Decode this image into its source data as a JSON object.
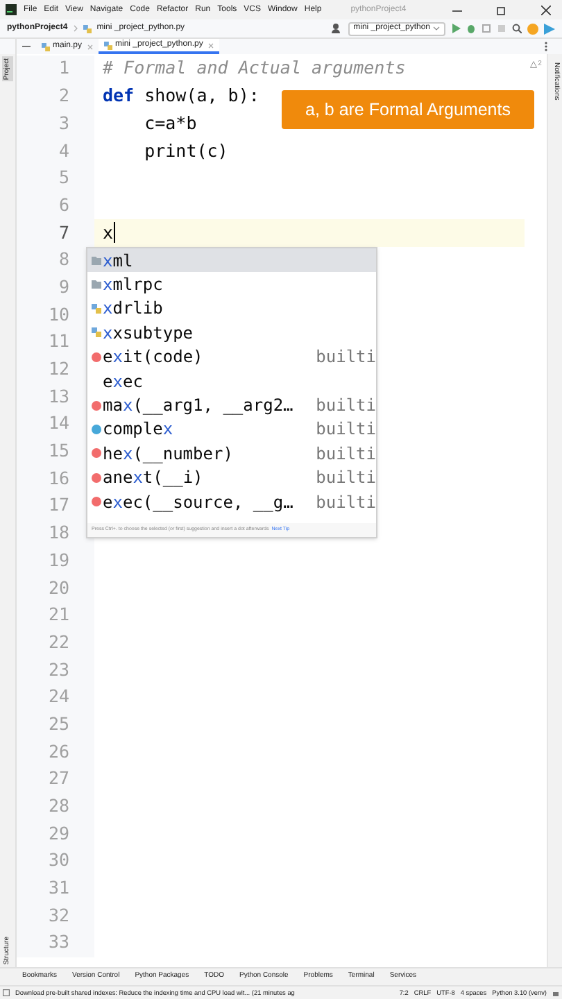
{
  "window": {
    "title": "pythonProject4",
    "menu": [
      "File",
      "Edit",
      "View",
      "Navigate",
      "Code",
      "Refactor",
      "Run",
      "Tools",
      "VCS",
      "Window",
      "Help"
    ]
  },
  "breadcrumb": [
    "pythonProject4",
    "mini _project_python.py"
  ],
  "run_config": "mini _project_python",
  "tabs": [
    {
      "label": "main.py",
      "selected": false
    },
    {
      "label": "mini _project_python.py",
      "selected": true
    }
  ],
  "side_labels": {
    "left_top": "Project",
    "left_bottom": "Structure",
    "right": "Notifications"
  },
  "inspection": {
    "warnings": "2"
  },
  "editor": {
    "lines": [
      {
        "number": "1",
        "current": false,
        "tokens": [
          {
            "kind": "comment",
            "text": "# Formal and Actual arguments"
          }
        ]
      },
      {
        "number": "2",
        "current": false,
        "tokens": [
          {
            "kind": "keyword",
            "text": "def"
          },
          {
            "kind": "plain",
            "text": " show(a, b):"
          }
        ]
      },
      {
        "number": "3",
        "current": false,
        "tokens": [
          {
            "kind": "plain",
            "text": "    c=a*b"
          }
        ]
      },
      {
        "number": "4",
        "current": false,
        "tokens": [
          {
            "kind": "plain",
            "text": "    print(c)"
          }
        ]
      },
      {
        "number": "5",
        "current": false
      },
      {
        "number": "6",
        "current": false
      },
      {
        "number": "7",
        "current": true,
        "tokens": [
          {
            "kind": "plain",
            "text": "x"
          }
        ]
      },
      {
        "number": "8",
        "current": false
      },
      {
        "number": "9",
        "current": false
      },
      {
        "number": "10",
        "current": false
      },
      {
        "number": "11",
        "current": false
      },
      {
        "number": "12",
        "current": false
      },
      {
        "number": "13",
        "current": false
      },
      {
        "number": "14",
        "current": false
      },
      {
        "number": "15",
        "current": false
      },
      {
        "number": "16",
        "current": false
      },
      {
        "number": "17",
        "current": false
      },
      {
        "number": "18",
        "current": false
      },
      {
        "number": "19",
        "current": false
      },
      {
        "number": "20",
        "current": false
      },
      {
        "number": "21",
        "current": false
      },
      {
        "number": "22",
        "current": false
      },
      {
        "number": "23",
        "current": false
      },
      {
        "number": "24",
        "current": false
      },
      {
        "number": "25",
        "current": false
      },
      {
        "number": "26",
        "current": false
      },
      {
        "number": "27",
        "current": false
      },
      {
        "number": "28",
        "current": false
      },
      {
        "number": "29",
        "current": false
      },
      {
        "number": "30",
        "current": false
      },
      {
        "number": "31",
        "current": false
      },
      {
        "number": "32",
        "current": false
      },
      {
        "number": "33",
        "current": false
      }
    ]
  },
  "annotation": "a, b are Formal Arguments",
  "completion": {
    "items": [
      {
        "kind": "package",
        "match": "x",
        "after": "ml",
        "selected": true
      },
      {
        "kind": "package",
        "match": "x",
        "after": "mlrpc",
        "selected": false
      },
      {
        "kind": "module",
        "match": "x",
        "after": "drlib",
        "selected": false
      },
      {
        "kind": "module",
        "match": "x",
        "after": "xsubtype",
        "selected": false
      },
      {
        "kind": "function",
        "before": "e",
        "match": "x",
        "after": "it(code)",
        "type": "builti",
        "selected": false
      },
      {
        "kind": "keyword",
        "before": "e",
        "match": "x",
        "after": "ec",
        "selected": false
      },
      {
        "kind": "function",
        "before": "ma",
        "match": "x",
        "after": "(__arg1, __arg2…",
        "type": "builti",
        "selected": false
      },
      {
        "kind": "class",
        "before": "comple",
        "match": "x",
        "type": "builti",
        "selected": false
      },
      {
        "kind": "function",
        "before": "he",
        "match": "x",
        "after": "(__number)",
        "type": "builti",
        "selected": false
      },
      {
        "kind": "function",
        "before": "ane",
        "match": "x",
        "after": "t(__i)",
        "type": "builti",
        "selected": false
      },
      {
        "kind": "function",
        "before": "e",
        "match": "x",
        "after": "ec(__source, __g…",
        "type": "builti",
        "selected": false
      }
    ],
    "hint": "Press Ctrl+. to choose the selected (or first) suggestion and insert a dot afterwards",
    "hint_link": "Next Tip"
  },
  "tool_windows": [
    "Bookmarks",
    "Version Control",
    "Python Packages",
    "TODO",
    "Python Console",
    "Problems",
    "Terminal",
    "Services"
  ],
  "status_bar": {
    "message": "Download pre-built shared indexes: Reduce the indexing time and CPU load wit... (21 minutes ag",
    "items": [
      "7:2",
      "CRLF",
      "UTF-8",
      "4 spaces",
      "Python 3.10 (venv)"
    ]
  }
}
